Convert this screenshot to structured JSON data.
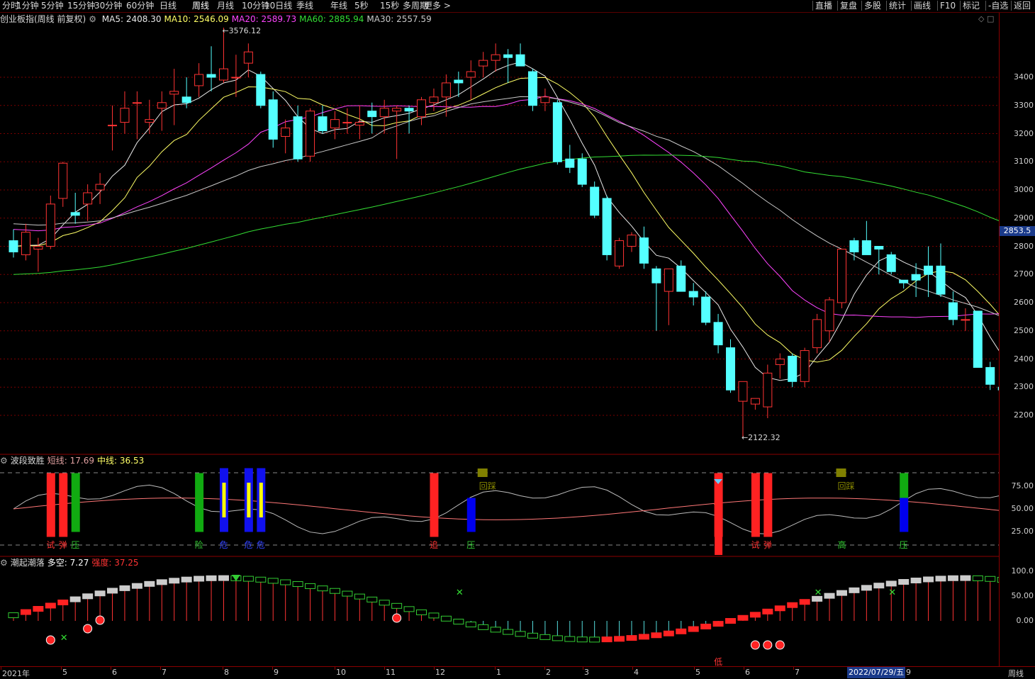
{
  "toolbar": {
    "periods": [
      "分时",
      "1分钟",
      "5分钟",
      "15分钟",
      "30分钟",
      "60分钟",
      "日线",
      "周线",
      "月线",
      "10分钟",
      "10日线",
      "季线",
      "年线",
      "5秒",
      "15秒",
      "多周期",
      "更多"
    ],
    "active": "周线",
    "right_items": [
      "直播",
      "复盘",
      "多股",
      "统计",
      "画线",
      "F10",
      "标记",
      "-自选",
      "返回"
    ]
  },
  "main_legend": {
    "title": "创业板指(周线 前复权)",
    "items": [
      {
        "label": "MA5: 2408.30",
        "color": "#e8e8e8"
      },
      {
        "label": "MA10: 2546.09",
        "color": "#ffff66"
      },
      {
        "label": "MA20: 2589.73",
        "color": "#ff44ff"
      },
      {
        "label": "MA60: 2885.94",
        "color": "#33dd33"
      },
      {
        "label": "MA30: 2557.59",
        "color": "#c8c8c8"
      }
    ]
  },
  "price_axis": [
    "3400",
    "3300",
    "3200",
    "3100",
    "3000",
    "2900",
    "2800",
    "2700",
    "2600",
    "2500",
    "2400",
    "2300",
    "2200"
  ],
  "current_price": "2853.5",
  "annotations": {
    "high": "3576.12",
    "low": "2122.32"
  },
  "ind1": {
    "name": "波段致胜",
    "short": "短线: 17.69",
    "mid": "中线: 36.53",
    "axis": [
      "75.00",
      "50.00",
      "25.00"
    ],
    "marks": [
      "试",
      "弹",
      "压",
      "险",
      "危",
      "危",
      "危",
      "追",
      "压",
      "回踩",
      "试",
      "弹",
      "高",
      "压",
      "回踩"
    ]
  },
  "ind2": {
    "name": "潮起潮落",
    "duokong": "多空: 7.27",
    "strength": "强度: 37.25",
    "axis": [
      "100.0",
      "50.00",
      "0.00"
    ],
    "low_mark": "低"
  },
  "time_axis": {
    "labels": [
      "2021年",
      "5",
      "6",
      "7",
      "8",
      "9",
      "10",
      "11",
      "12",
      "1",
      "2",
      "3",
      "4",
      "5",
      "6",
      "7",
      "9"
    ],
    "cursor": "2022/07/29/五",
    "period": "周线"
  },
  "chart_data": {
    "type": "candlestick",
    "title": "创业板指(周线 前复权)",
    "ylim": [
      2100,
      3600
    ],
    "candles": [
      {
        "o": 2820,
        "h": 2860,
        "l": 2760,
        "c": 2780
      },
      {
        "o": 2770,
        "h": 2880,
        "l": 2750,
        "c": 2850
      },
      {
        "o": 2790,
        "h": 2830,
        "l": 2710,
        "c": 2800
      },
      {
        "o": 2800,
        "h": 2980,
        "l": 2790,
        "c": 2950
      },
      {
        "o": 2970,
        "h": 3100,
        "l": 2940,
        "c": 3095
      },
      {
        "o": 2920,
        "h": 2990,
        "l": 2880,
        "c": 2910
      },
      {
        "o": 2950,
        "h": 3020,
        "l": 2890,
        "c": 2990
      },
      {
        "o": 3000,
        "h": 3060,
        "l": 2950,
        "c": 3020
      },
      {
        "o": 3230,
        "h": 3300,
        "l": 3140,
        "c": 3230
      },
      {
        "o": 3240,
        "h": 3350,
        "l": 3200,
        "c": 3290
      },
      {
        "o": 3310,
        "h": 3350,
        "l": 3180,
        "c": 3310
      },
      {
        "o": 3240,
        "h": 3320,
        "l": 3200,
        "c": 3250
      },
      {
        "o": 3290,
        "h": 3350,
        "l": 3210,
        "c": 3310
      },
      {
        "o": 3340,
        "h": 3430,
        "l": 3230,
        "c": 3350
      },
      {
        "o": 3330,
        "h": 3400,
        "l": 3290,
        "c": 3310
      },
      {
        "o": 3370,
        "h": 3450,
        "l": 3330,
        "c": 3410
      },
      {
        "o": 3410,
        "h": 3510,
        "l": 3350,
        "c": 3400
      },
      {
        "o": 3390,
        "h": 3576,
        "l": 3380,
        "c": 3430
      },
      {
        "o": 3400,
        "h": 3480,
        "l": 3330,
        "c": 3400
      },
      {
        "o": 3450,
        "h": 3520,
        "l": 3400,
        "c": 3490
      },
      {
        "o": 3410,
        "h": 3420,
        "l": 3290,
        "c": 3300
      },
      {
        "o": 3320,
        "h": 3350,
        "l": 3150,
        "c": 3180
      },
      {
        "o": 3190,
        "h": 3250,
        "l": 3130,
        "c": 3220
      },
      {
        "o": 3260,
        "h": 3300,
        "l": 3100,
        "c": 3110
      },
      {
        "o": 3120,
        "h": 3290,
        "l": 3100,
        "c": 3280
      },
      {
        "o": 3260,
        "h": 3300,
        "l": 3200,
        "c": 3210
      },
      {
        "o": 3220,
        "h": 3280,
        "l": 3180,
        "c": 3250
      },
      {
        "o": 3240,
        "h": 3290,
        "l": 3200,
        "c": 3240
      },
      {
        "o": 3230,
        "h": 3300,
        "l": 3180,
        "c": 3240
      },
      {
        "o": 3280,
        "h": 3310,
        "l": 3200,
        "c": 3260
      },
      {
        "o": 3260,
        "h": 3320,
        "l": 3200,
        "c": 3290
      },
      {
        "o": 3280,
        "h": 3300,
        "l": 3110,
        "c": 3290
      },
      {
        "o": 3290,
        "h": 3300,
        "l": 3200,
        "c": 3280
      },
      {
        "o": 3260,
        "h": 3330,
        "l": 3230,
        "c": 3320
      },
      {
        "o": 3310,
        "h": 3360,
        "l": 3280,
        "c": 3330
      },
      {
        "o": 3330,
        "h": 3410,
        "l": 3260,
        "c": 3380
      },
      {
        "o": 3390,
        "h": 3420,
        "l": 3330,
        "c": 3380
      },
      {
        "o": 3400,
        "h": 3460,
        "l": 3320,
        "c": 3420
      },
      {
        "o": 3440,
        "h": 3490,
        "l": 3400,
        "c": 3460
      },
      {
        "o": 3460,
        "h": 3520,
        "l": 3420,
        "c": 3480
      },
      {
        "o": 3480,
        "h": 3500,
        "l": 3380,
        "c": 3470
      },
      {
        "o": 3480,
        "h": 3520,
        "l": 3440,
        "c": 3440
      },
      {
        "o": 3420,
        "h": 3430,
        "l": 3280,
        "c": 3300
      },
      {
        "o": 3310,
        "h": 3360,
        "l": 3280,
        "c": 3330
      },
      {
        "o": 3310,
        "h": 3320,
        "l": 3090,
        "c": 3100
      },
      {
        "o": 3110,
        "h": 3160,
        "l": 3060,
        "c": 3080
      },
      {
        "o": 3110,
        "h": 3130,
        "l": 3010,
        "c": 3020
      },
      {
        "o": 3010,
        "h": 3030,
        "l": 2900,
        "c": 2910
      },
      {
        "o": 2970,
        "h": 2980,
        "l": 2750,
        "c": 2770
      },
      {
        "o": 2730,
        "h": 2830,
        "l": 2720,
        "c": 2820
      },
      {
        "o": 2800,
        "h": 2850,
        "l": 2780,
        "c": 2840
      },
      {
        "o": 2830,
        "h": 2870,
        "l": 2720,
        "c": 2740
      },
      {
        "o": 2720,
        "h": 2730,
        "l": 2500,
        "c": 2670
      },
      {
        "o": 2640,
        "h": 2720,
        "l": 2520,
        "c": 2720
      },
      {
        "o": 2730,
        "h": 2750,
        "l": 2640,
        "c": 2640
      },
      {
        "o": 2640,
        "h": 2670,
        "l": 2590,
        "c": 2620
      },
      {
        "o": 2620,
        "h": 2640,
        "l": 2520,
        "c": 2530
      },
      {
        "o": 2530,
        "h": 2560,
        "l": 2420,
        "c": 2450
      },
      {
        "o": 2440,
        "h": 2470,
        "l": 2280,
        "c": 2290
      },
      {
        "o": 2250,
        "h": 2320,
        "l": 2122,
        "c": 2320
      },
      {
        "o": 2240,
        "h": 2260,
        "l": 2220,
        "c": 2260
      },
      {
        "o": 2230,
        "h": 2380,
        "l": 2190,
        "c": 2350
      },
      {
        "o": 2380,
        "h": 2420,
        "l": 2330,
        "c": 2400
      },
      {
        "o": 2410,
        "h": 2420,
        "l": 2300,
        "c": 2320
      },
      {
        "o": 2320,
        "h": 2440,
        "l": 2300,
        "c": 2430
      },
      {
        "o": 2440,
        "h": 2560,
        "l": 2420,
        "c": 2540
      },
      {
        "o": 2500,
        "h": 2620,
        "l": 2460,
        "c": 2610
      },
      {
        "o": 2600,
        "h": 2790,
        "l": 2580,
        "c": 2790
      },
      {
        "o": 2820,
        "h": 2830,
        "l": 2750,
        "c": 2780
      },
      {
        "o": 2820,
        "h": 2890,
        "l": 2780,
        "c": 2770
      },
      {
        "o": 2800,
        "h": 2800,
        "l": 2700,
        "c": 2790
      },
      {
        "o": 2770,
        "h": 2780,
        "l": 2700,
        "c": 2710
      },
      {
        "o": 2680,
        "h": 2680,
        "l": 2650,
        "c": 2670
      },
      {
        "o": 2700,
        "h": 2740,
        "l": 2620,
        "c": 2680
      },
      {
        "o": 2730,
        "h": 2800,
        "l": 2620,
        "c": 2700
      },
      {
        "o": 2730,
        "h": 2810,
        "l": 2620,
        "c": 2630
      },
      {
        "o": 2600,
        "h": 2640,
        "l": 2520,
        "c": 2540
      },
      {
        "o": 2540,
        "h": 2580,
        "l": 2500,
        "c": 2540
      },
      {
        "o": 2570,
        "h": 2570,
        "l": 2390,
        "c": 2370
      },
      {
        "o": 2370,
        "h": 2390,
        "l": 2290,
        "c": 2310
      },
      {
        "o": 2300,
        "h": 2380,
        "l": 2290,
        "c": 2290
      }
    ]
  }
}
